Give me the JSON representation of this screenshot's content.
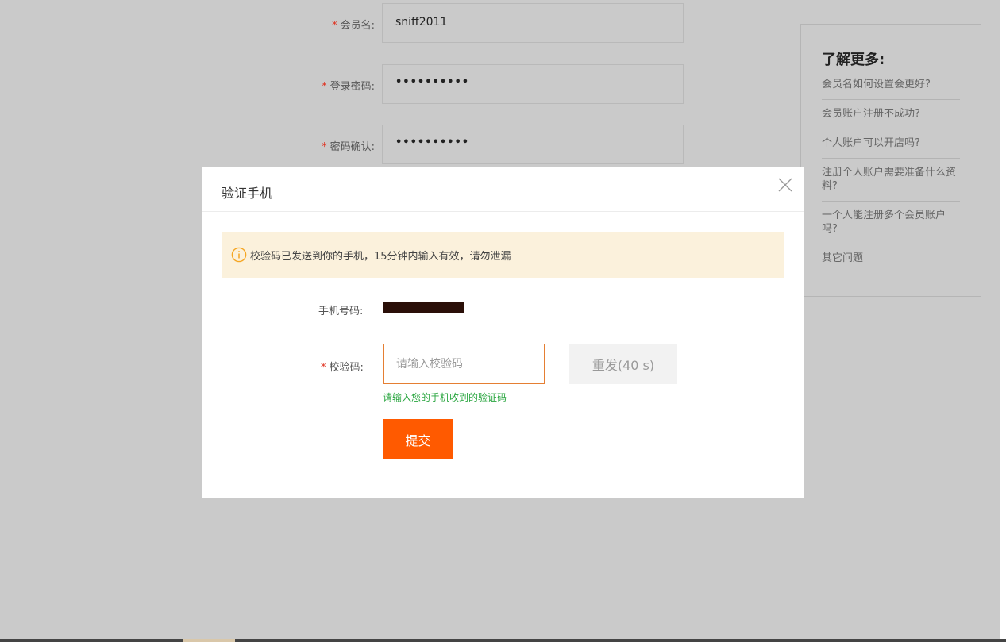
{
  "form": {
    "required_mark": "*",
    "username": {
      "label": "会员名:",
      "value": "sniff2011"
    },
    "password": {
      "label": "登录密码:",
      "value": "••••••••••"
    },
    "password_confirm": {
      "label": "密码确认:",
      "value": "••••••••••"
    }
  },
  "help": {
    "title": "了解更多:",
    "links": [
      "会员名如何设置会更好?",
      "会员账户注册不成功?",
      "个人账户可以开店吗?",
      "注册个人账户需要准备什么资料?",
      "一个人能注册多个会员账户吗?",
      "其它问题"
    ]
  },
  "modal": {
    "title": "验证手机",
    "notice": "校验码已发送到你的手机，15分钟内输入有效，请勿泄漏",
    "phone_label": "手机号码:",
    "code_label": "校验码:",
    "code_placeholder": "请输入校验码",
    "code_value": "",
    "code_hint": "请输入您的手机收到的验证码",
    "resend_label": "重发(40 s)",
    "submit_label": "提交"
  },
  "colors": {
    "accent": "#ff5a00",
    "required": "#e0301e",
    "hint_green": "#2aa640",
    "notice_bg": "#fbf1dc",
    "overlay_bg": "#cacaca"
  },
  "icons": {
    "close": "close-icon",
    "info": "info-icon"
  }
}
